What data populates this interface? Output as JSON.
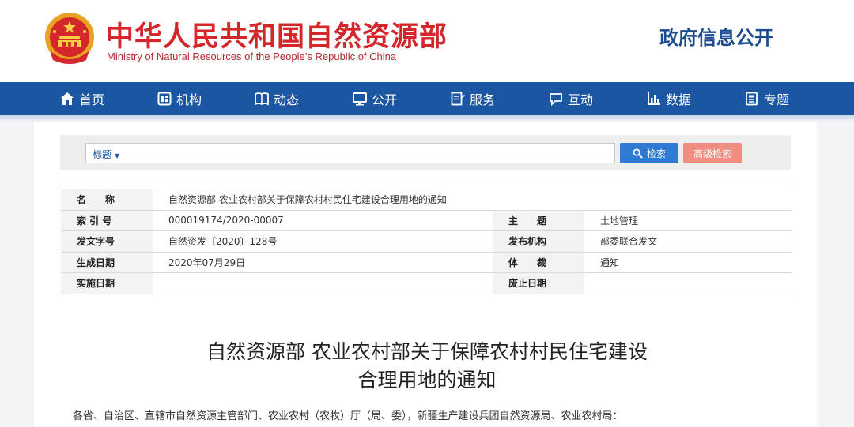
{
  "header": {
    "site_name_cn": "中华人民共和国自然资源部",
    "site_name_en": "Ministry of Natural Resources of the People’s Republic of China",
    "section_title": "政府信息公开"
  },
  "nav": {
    "items": [
      {
        "label": "首页",
        "icon": "home-icon"
      },
      {
        "label": "机构",
        "icon": "org-icon"
      },
      {
        "label": "动态",
        "icon": "book-icon"
      },
      {
        "label": "公开",
        "icon": "monitor-icon"
      },
      {
        "label": "服务",
        "icon": "edit-doc-icon"
      },
      {
        "label": "互动",
        "icon": "chat-icon"
      },
      {
        "label": "数据",
        "icon": "bar-chart-icon"
      },
      {
        "label": "专题",
        "icon": "topic-icon"
      }
    ]
  },
  "search": {
    "scope_label": "标题",
    "value": "",
    "search_label": "检索",
    "advanced_label": "高级检索"
  },
  "meta": {
    "name_label": "名　　称",
    "name_value": "自然资源部 农业农村部关于保障农村村民住宅建设合理用地的通知",
    "index_label": "索 引 号",
    "index_value": "000019174/2020-00007",
    "subject_label": "主　　题",
    "subject_value": "土地管理",
    "docno_label": "发文字号",
    "docno_value": "自然资发〔2020〕128号",
    "issuer_label": "发布机构",
    "issuer_value": "部委联合发文",
    "created_label": "生成日期",
    "created_value": "2020年07月29日",
    "genre_label": "体　　裁",
    "genre_value": "通知",
    "effective_label": "实施日期",
    "effective_value": "",
    "abolish_label": "废止日期",
    "abolish_value": ""
  },
  "document": {
    "title_line1": "自然资源部 农业农村部关于保障农村村民住宅建设",
    "title_line2": "合理用地的通知",
    "salutation": "各省、自治区、直辖市自然资源主管部门、农业农村（农牧）厅（局、委），新疆生产建设兵团自然资源局、农业农村局："
  },
  "colors": {
    "brand_red": "#d4262b",
    "nav_blue": "#1a56a2",
    "search_blue": "#2f7bd3",
    "advanced_pink": "#ef8d83"
  }
}
